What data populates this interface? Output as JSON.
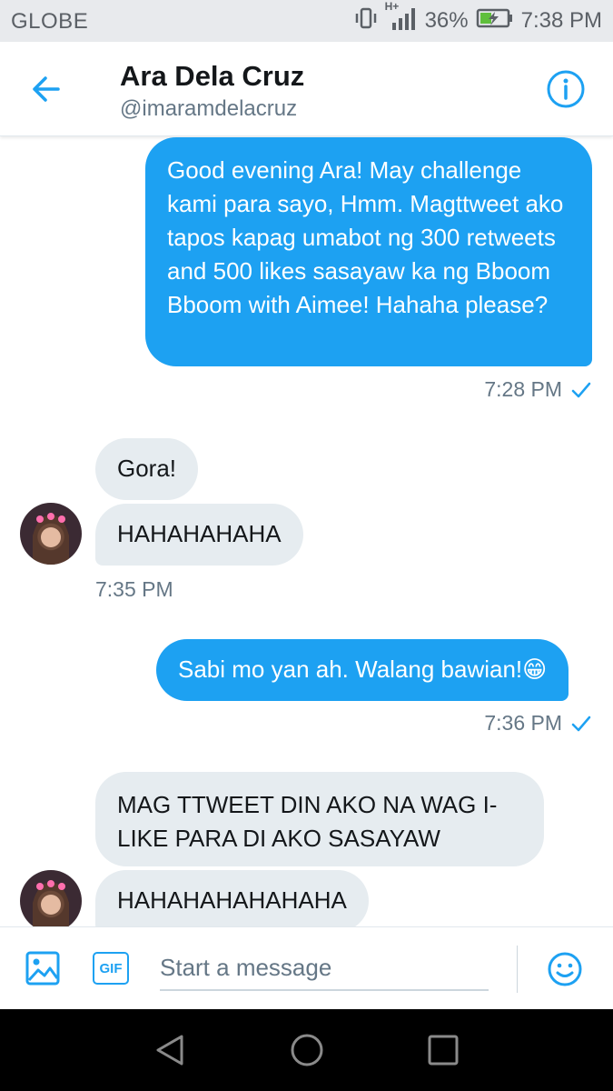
{
  "status_bar": {
    "carrier": "GLOBE",
    "network": "H+",
    "battery_percent": "36%",
    "time": "7:38 PM",
    "icons": [
      "vibrate-icon",
      "signal-icon",
      "battery-charging-icon"
    ]
  },
  "header": {
    "name": "Ara Dela Cruz",
    "handle": "@imaramdelacruz",
    "icons": [
      "back-arrow-icon",
      "info-icon"
    ]
  },
  "messages": [
    {
      "direction": "out",
      "text": "Good evening Ara! May challenge kami para sayo, Hmm. Magttweet ako tapos kapag umabot ng 300 retweets and 500 likes sasayaw ka ng Bboom Bboom with Aimee! Hahaha please?"
    },
    {
      "direction": "out_meta",
      "time": "7:28 PM"
    },
    {
      "direction": "in",
      "text": "Gora!"
    },
    {
      "direction": "in",
      "text": "HAHAHAHAHA"
    },
    {
      "direction": "in_meta",
      "time": "7:35 PM"
    },
    {
      "direction": "out",
      "text": "Sabi mo yan ah. Walang bawian!😁"
    },
    {
      "direction": "out_meta",
      "time": "7:36 PM"
    },
    {
      "direction": "in",
      "text": "MAG TTWEET DIN AKO NA WAG I-LIKE PARA DI AKO SASAYAW"
    },
    {
      "direction": "in",
      "text": "HAHAHAHAHAHAHA"
    }
  ],
  "composer": {
    "placeholder": "Start a message",
    "gif_label": "GIF",
    "icons": [
      "image-icon",
      "gif-icon",
      "emoji-icon"
    ]
  },
  "colors": {
    "accent": "#1da1f2",
    "incoming_bubble": "#e6ecf0",
    "secondary_text": "#657786"
  },
  "nav_bar": {
    "icons": [
      "back-triangle-icon",
      "home-circle-icon",
      "recents-square-icon"
    ]
  }
}
